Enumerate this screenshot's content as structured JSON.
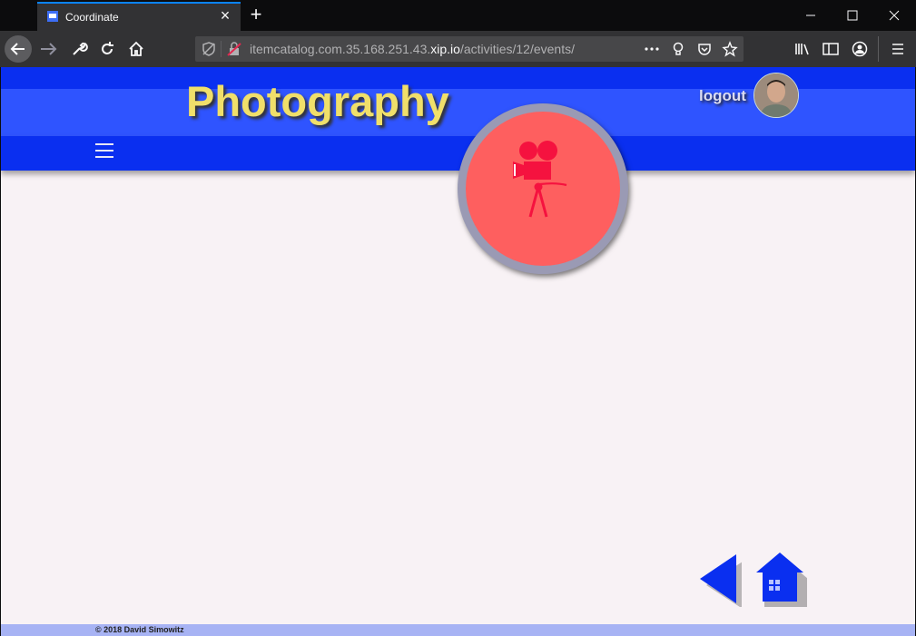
{
  "browser": {
    "tab_title": "Coordinate",
    "url_prefix": "itemcatalog.com.35.168.251.43.",
    "url_host": "xip.io",
    "url_path": "/activities/12/events/"
  },
  "header": {
    "title": "Photography",
    "logout_label": "logout"
  },
  "activity": {
    "icon": "movie-camera-icon",
    "color": "#fe5f5f",
    "ring_color": "#9a9ab4"
  },
  "footer": {
    "copyright": "© 2018 David Simowitz"
  },
  "colors": {
    "brand_blue": "#0a2ff0",
    "title_yellow": "#f0df6a",
    "footer": "#a7b3f4"
  }
}
